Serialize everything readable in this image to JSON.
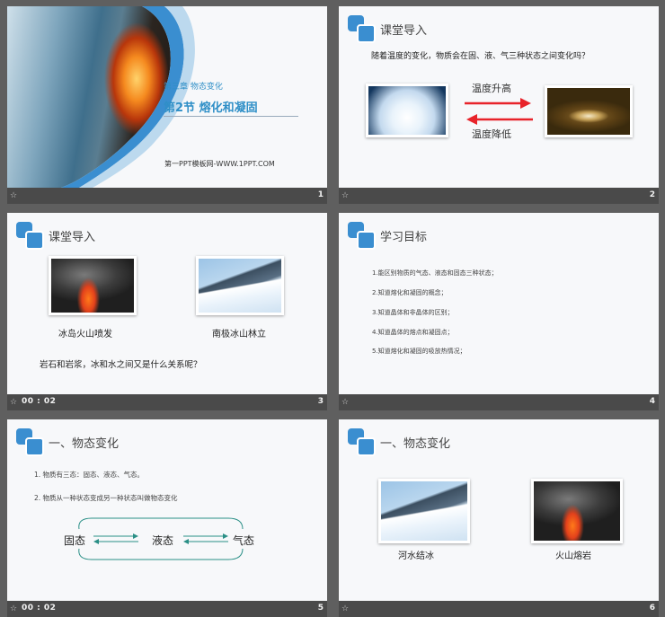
{
  "colors": {
    "accent": "#3a8ed0",
    "teal": "#2a8f86",
    "red": "#e8232a"
  },
  "slides": [
    {
      "chapter": "第三章  物态变化",
      "section": "第2节  熔化和凝固",
      "site": "第一PPT模板网-WWW.1PPT.COM",
      "time": "",
      "number": "1"
    },
    {
      "title": "课堂导入",
      "question": "随着温度的变化，物质会在固、液、气三种状态之间变化吗？",
      "up_label": "温度升高",
      "down_label": "温度降低",
      "time": "",
      "number": "2"
    },
    {
      "title": "课堂导入",
      "caption_left": "冰岛火山喷发",
      "caption_right": "南极冰山林立",
      "question": "岩石和岩浆，冰和水之间又是什么关系呢？",
      "time": "00 : 02",
      "number": "3"
    },
    {
      "title": "学习目标",
      "goals": [
        "1.能区别物质的气态、液态和固态三种状态；",
        "2.知道熔化和凝固的概念；",
        "3.知道晶体和非晶体的区别；",
        "4.知道晶体的熔点和凝固点；",
        "5.知道熔化和凝固的吸放热情况；"
      ],
      "time": "",
      "number": "4"
    },
    {
      "title": "一、物态变化",
      "items": [
        "1.   物质有三态：固态、液态、气态。",
        "2.   物质从一种状态变成另一种状态叫做物态变化"
      ],
      "states": [
        "固态",
        "液态",
        "气态"
      ],
      "time": "00 : 02",
      "number": "5"
    },
    {
      "title": "一、物态变化",
      "caption_left": "河水结冰",
      "caption_right": "火山熔岩",
      "time": "",
      "number": "6"
    }
  ]
}
